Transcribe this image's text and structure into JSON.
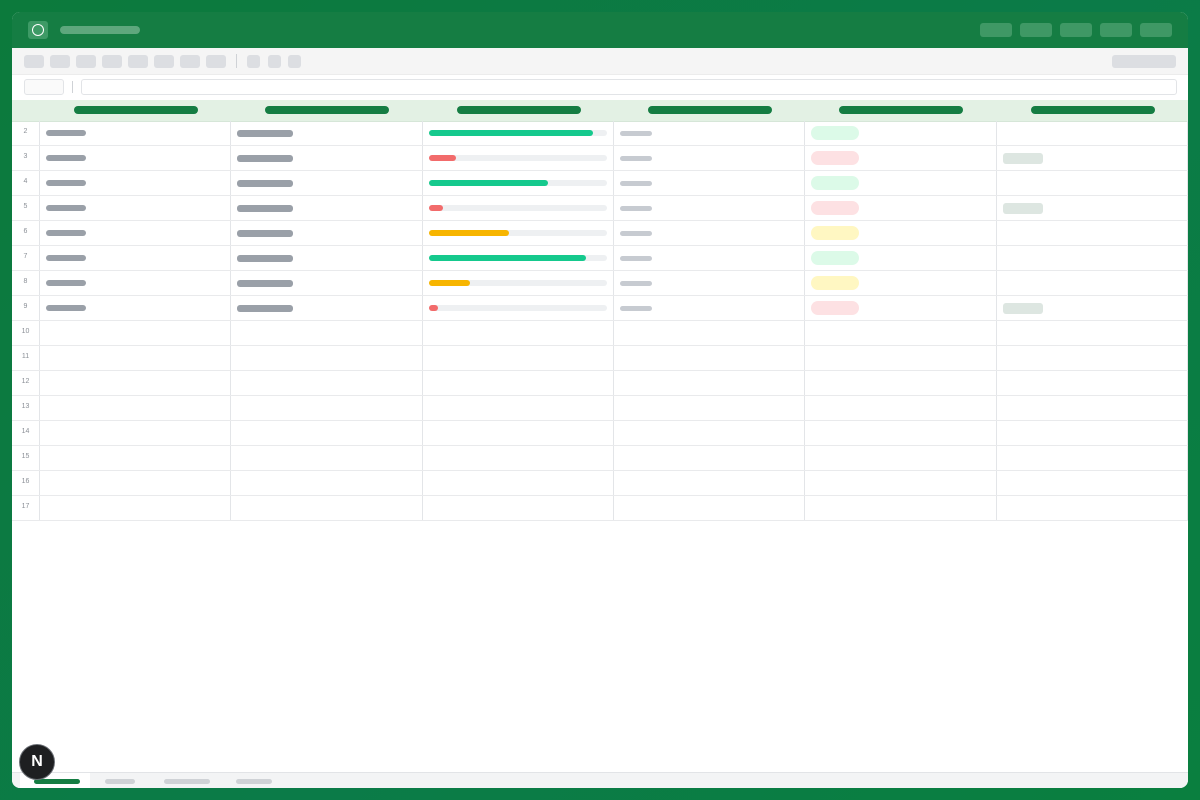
{
  "theme": {
    "accent": "#157d43",
    "header_bg": "#e3f1e4",
    "status_green": "#15c98d",
    "status_red": "#f26b6b",
    "status_yellow": "#f7b500",
    "pill_green": "#dcfae8",
    "pill_red": "#fde1e3",
    "pill_yellow": "#fff7c2"
  },
  "icons": {
    "app": "circle-icon",
    "assistant": "n-logo-icon"
  },
  "assistant_button": {
    "letter": "N"
  },
  "rows": [
    {
      "num": "2",
      "progress": 0.92,
      "status": "green",
      "tag": false
    },
    {
      "num": "3",
      "progress": 0.15,
      "status": "red",
      "tag": true
    },
    {
      "num": "4",
      "progress": 0.67,
      "status": "green",
      "tag": false
    },
    {
      "num": "5",
      "progress": 0.08,
      "status": "red",
      "tag": true
    },
    {
      "num": "6",
      "progress": 0.45,
      "status": "yellow",
      "tag": false
    },
    {
      "num": "7",
      "progress": 0.88,
      "status": "green",
      "tag": false
    },
    {
      "num": "8",
      "progress": 0.23,
      "status": "yellow",
      "tag": false
    },
    {
      "num": "9",
      "progress": 0.05,
      "status": "red",
      "tag": true
    },
    {
      "num": "10"
    },
    {
      "num": "11"
    },
    {
      "num": "12"
    },
    {
      "num": "13"
    },
    {
      "num": "14"
    },
    {
      "num": "15"
    },
    {
      "num": "16"
    },
    {
      "num": "17"
    }
  ],
  "sheet_tabs_count": 4,
  "active_sheet_index": 0
}
